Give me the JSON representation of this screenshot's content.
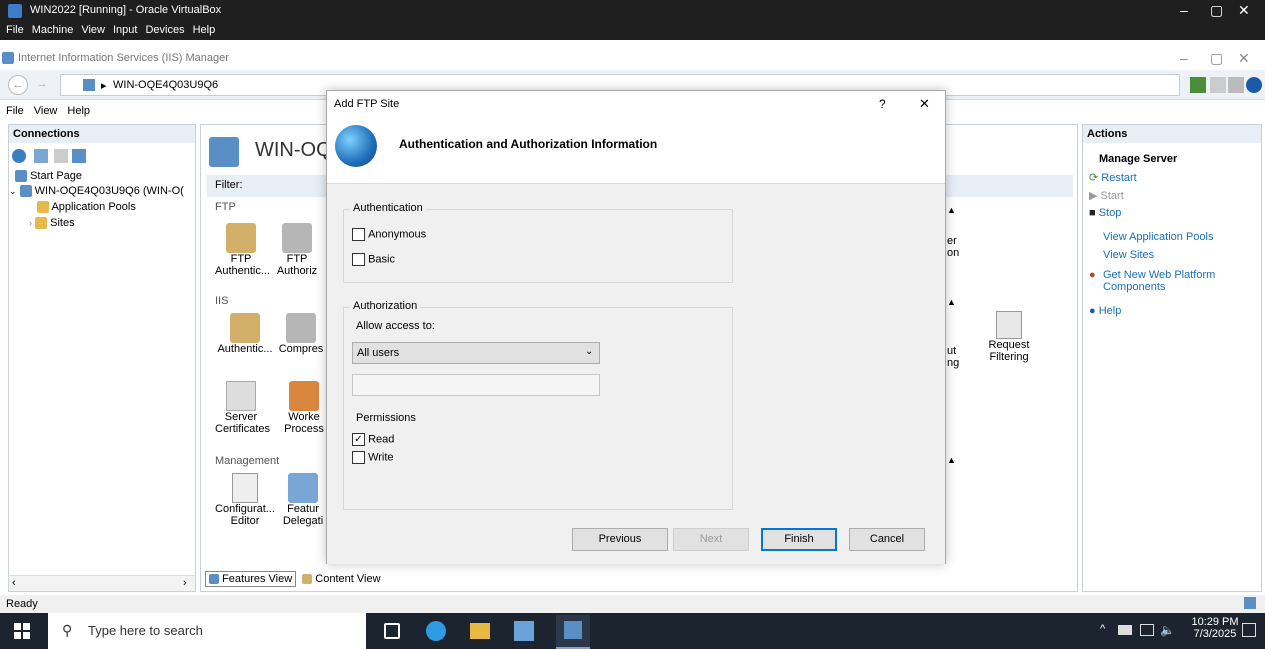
{
  "vbox": {
    "title": "WIN2022 [Running] - Oracle VirtualBox",
    "menu": [
      "File",
      "Machine",
      "View",
      "Input",
      "Devices",
      "Help"
    ],
    "controls": {
      "minimize": "–",
      "restore": "▢",
      "close": "✕"
    }
  },
  "iis": {
    "title": "Internet Information Services (IIS) Manager",
    "breadcrumb": "WIN-OQE4Q03U9Q6",
    "breadcrumb_sep": "▸",
    "menu": [
      "File",
      "View",
      "Help"
    ],
    "controls": {
      "minimize": "–",
      "restore": "▢",
      "close": "✕"
    }
  },
  "connections": {
    "header": "Connections",
    "tree": [
      {
        "label": "Start Page",
        "icon": "start-page-icon"
      },
      {
        "label": "WIN-OQE4Q03U9Q6 (WIN-O(",
        "icon": "server-icon"
      },
      {
        "label": "Application Pools",
        "icon": "app-pool-icon"
      },
      {
        "label": "Sites",
        "icon": "sites-folder-icon"
      }
    ]
  },
  "center": {
    "server_heading": "WIN-OQI",
    "filter_label": "Filter:",
    "sections": {
      "ftp": "FTP",
      "iis": "IIS",
      "management": "Management"
    },
    "ftp_items": [
      {
        "label1": "FTP",
        "label2": "Authentic..."
      },
      {
        "label1": "FTP",
        "label2": "Authoriz"
      }
    ],
    "iis_items": [
      {
        "label1": "Authentic...",
        "label2": ""
      },
      {
        "label1": "Compres",
        "label2": ""
      }
    ],
    "iis_items_row2": [
      {
        "label1": "Server",
        "label2": "Certificates"
      },
      {
        "label1": "Worke",
        "label2": "Process"
      }
    ],
    "mgmt_items": [
      {
        "label1": "Configurat...",
        "label2": "Editor"
      },
      {
        "label1": "Featur",
        "label2": "Delegati"
      }
    ],
    "right_partial": [
      {
        "label1": "er",
        "label2": "on"
      },
      {
        "label1": "ut",
        "label2": "ng"
      }
    ],
    "request_filtering": {
      "label1": "Request",
      "label2": "Filtering"
    },
    "bottom_tabs": [
      "Features View",
      "Content View"
    ]
  },
  "actions": {
    "header": "Actions",
    "manage_server": "Manage Server",
    "items": [
      {
        "label": "Restart",
        "icon": "restart-icon",
        "enabled": true
      },
      {
        "label": "Start",
        "icon": "start-icon",
        "enabled": false
      },
      {
        "label": "Stop",
        "icon": "stop-icon",
        "enabled": true
      }
    ],
    "links": [
      "View Application Pools",
      "View Sites"
    ],
    "web_platform": "Get New Web Platform Components",
    "help": "Help"
  },
  "dialog": {
    "title": "Add FTP Site",
    "help_btn": "?",
    "close_btn": "✕",
    "heading": "Authentication and Authorization Information",
    "authentication_group": "Authentication",
    "anonymous": {
      "label": "Anonymous",
      "checked": false
    },
    "basic": {
      "label": "Basic",
      "checked": false
    },
    "authorization_group": "Authorization",
    "allow_access_label": "Allow access to:",
    "allow_access_value": "All users",
    "user_text_value": "",
    "permissions_label": "Permissions",
    "read": {
      "label": "Read",
      "checked": true,
      "mark": "✓"
    },
    "write": {
      "label": "Write",
      "checked": false
    },
    "buttons": {
      "previous": "Previous",
      "next": "Next",
      "finish": "Finish",
      "cancel": "Cancel"
    }
  },
  "status": {
    "text": "Ready"
  },
  "taskbar": {
    "search_placeholder": "Type here to search",
    "time": "10:29 PM",
    "date": "7/3/2025"
  },
  "colors": {
    "link_blue": "#1a6fb5",
    "accent": "#0078d7",
    "taskbar": "#1c2430"
  }
}
